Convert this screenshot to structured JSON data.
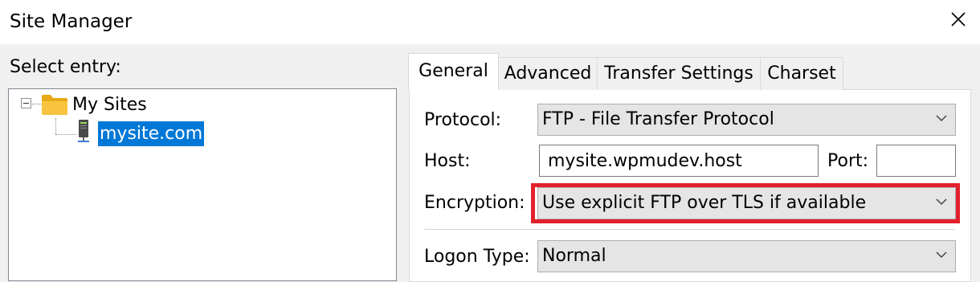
{
  "window": {
    "title": "Site Manager",
    "close_icon": "close-icon"
  },
  "left_panel": {
    "select_label": "Select entry:",
    "tree": {
      "root": {
        "label": "My Sites",
        "icon": "folder-icon",
        "expanded": true
      },
      "children": [
        {
          "label": "mysite.com",
          "icon": "server-icon",
          "selected": true
        }
      ]
    }
  },
  "tabs": [
    {
      "label": "General",
      "active": true
    },
    {
      "label": "Advanced",
      "active": false
    },
    {
      "label": "Transfer Settings",
      "active": false
    },
    {
      "label": "Charset",
      "active": false
    }
  ],
  "general": {
    "protocol_label": "Protocol:",
    "protocol_value": "FTP - File Transfer Protocol",
    "host_label": "Host:",
    "host_value": "mysite.wpmudev.host",
    "port_label": "Port:",
    "port_value": "",
    "encryption_label": "Encryption:",
    "encryption_value": "Use explicit FTP over TLS if available",
    "logon_label": "Logon Type:",
    "logon_value": "Normal"
  },
  "colors": {
    "selection": "#0078d7",
    "highlight": "#e3202b",
    "folder": "#f8c43f",
    "window_bg": "#f0f0f0"
  }
}
